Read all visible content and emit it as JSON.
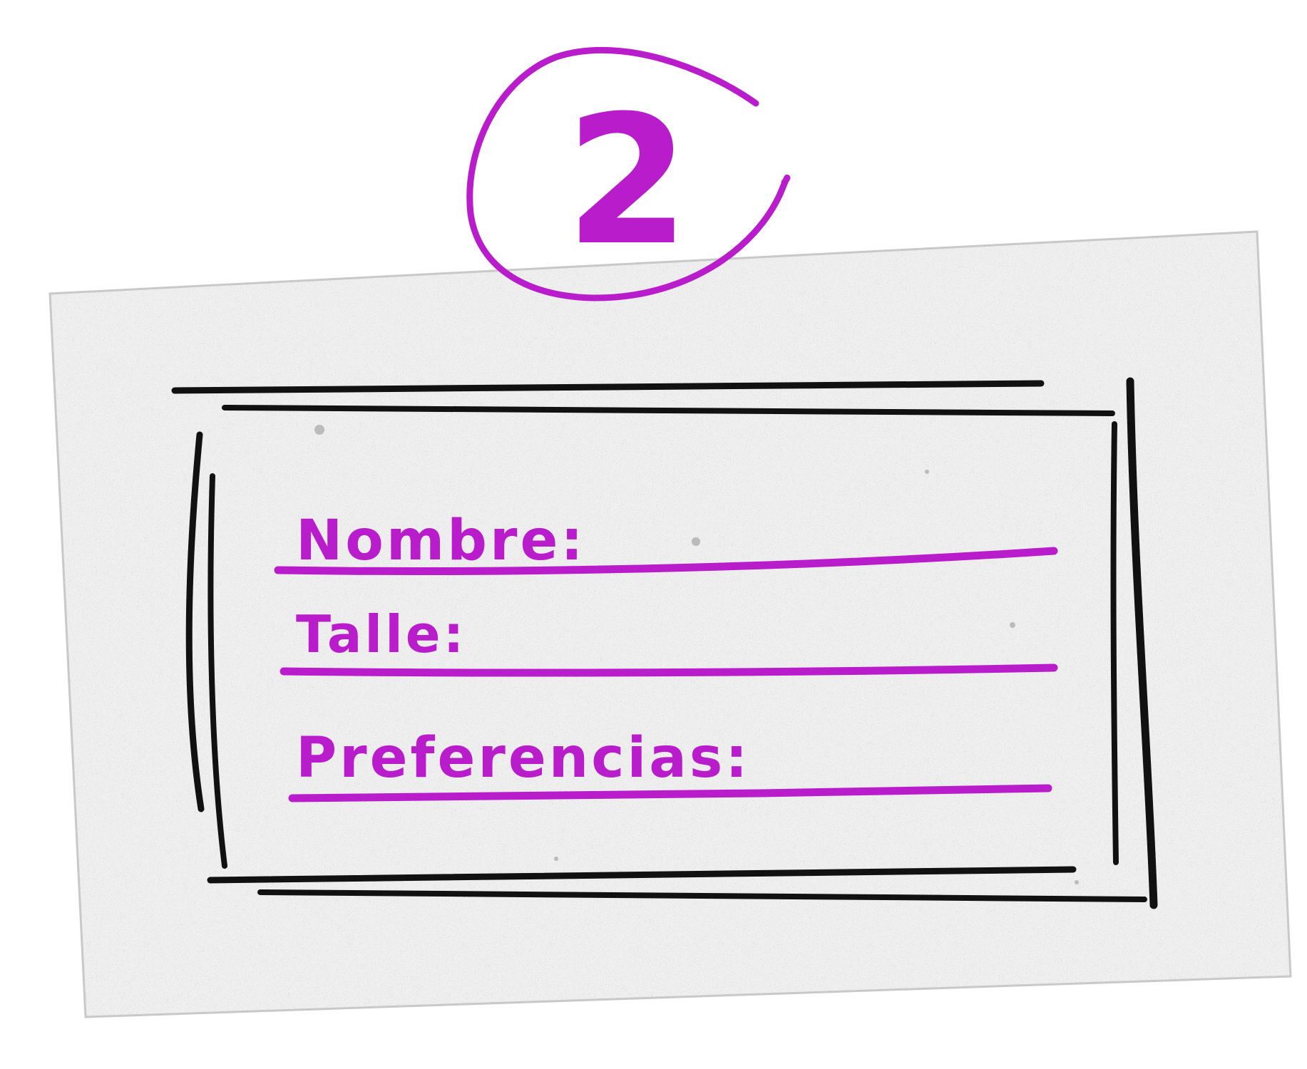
{
  "badge": {
    "number": "2"
  },
  "form": {
    "fields": [
      {
        "label": "Nombre:"
      },
      {
        "label": "Talle:"
      },
      {
        "label": "Preferencias:"
      }
    ]
  },
  "colors": {
    "accent": "#B91CCB",
    "ink": "#111111",
    "card": "#EFEFEF",
    "card_border": "#C9C9C9"
  }
}
